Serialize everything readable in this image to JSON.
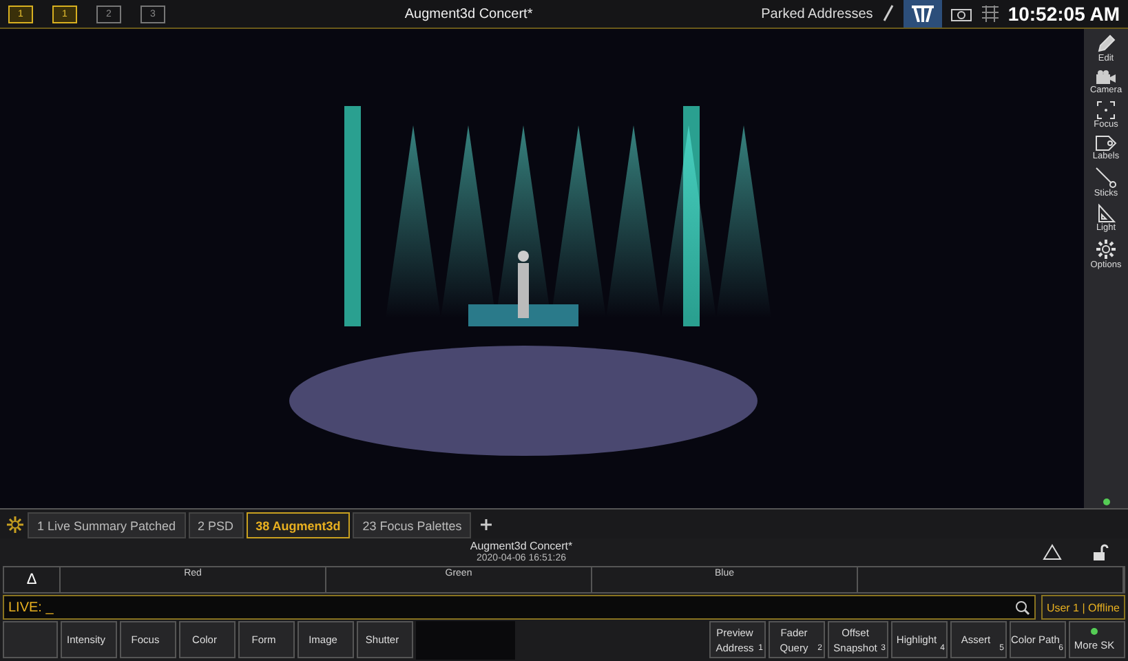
{
  "top_bar": {
    "monitors": [
      {
        "label": "1",
        "active": true
      },
      {
        "label": "1",
        "active": true
      },
      {
        "label": "2",
        "active": false
      },
      {
        "label": "3",
        "active": false
      }
    ],
    "title": "Augment3d Concert*",
    "parked": "Parked Addresses",
    "time": "10:52:05 AM",
    "xt_selected": true
  },
  "tools": [
    {
      "label": "Edit",
      "kind": "pencil"
    },
    {
      "label": "Camera",
      "kind": "camera"
    },
    {
      "label": "Focus",
      "kind": "focus"
    },
    {
      "label": "Labels",
      "kind": "tag"
    },
    {
      "label": "Sticks",
      "kind": "stick"
    },
    {
      "label": "Light",
      "kind": "triangle"
    },
    {
      "label": "Options",
      "kind": "gear"
    }
  ],
  "tabs": [
    {
      "label": "1 Live Summary Patched",
      "selected": false
    },
    {
      "label": "2 PSD",
      "selected": false
    },
    {
      "label": "38 Augment3d",
      "selected": true
    },
    {
      "label": "23 Focus Palettes",
      "selected": false
    }
  ],
  "info": {
    "title": "Augment3d Concert*",
    "date": "2020-04-06 16:51:26"
  },
  "color_row": {
    "delta": "Δ",
    "cells": [
      "Red",
      "Green",
      "Blue"
    ]
  },
  "command_line": {
    "value": "LIVE: _",
    "user": "User 1 | Offline"
  },
  "softkeys_left": [
    "Intensity",
    "Focus",
    "Color",
    "Form",
    "Image",
    "Shutter"
  ],
  "softkeys_right": [
    {
      "lines": [
        "Preview",
        "Address"
      ],
      "number": "1"
    },
    {
      "lines": [
        "Fader",
        "Query"
      ],
      "number": "2"
    },
    {
      "lines": [
        "Offset",
        "Snapshot"
      ],
      "number": "3"
    },
    {
      "lines": [
        "Highlight"
      ],
      "number": "4"
    },
    {
      "lines": [
        "Assert"
      ],
      "number": "5"
    },
    {
      "lines": [
        "Color Path"
      ],
      "number": "6"
    },
    {
      "lines": [
        "More SK"
      ],
      "led": true
    }
  ]
}
